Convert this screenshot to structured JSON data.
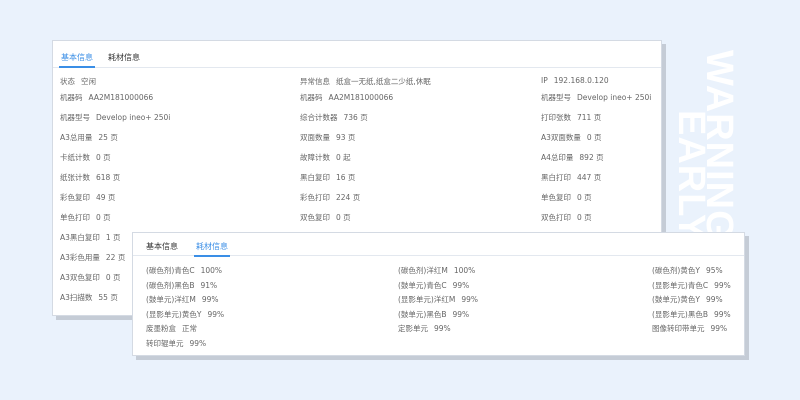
{
  "watermark": {
    "line1": "WARNING",
    "line2": "EARLY"
  },
  "colors": {
    "accent": "#3a8ee6",
    "background": "#eaf2fc"
  },
  "back_card": {
    "tabs": [
      "基本信息",
      "耗材信息"
    ],
    "active_tab": 0,
    "columns": [
      [
        [
          "状态",
          "空闲"
        ],
        [
          "机器码",
          "AA2M181000066"
        ],
        [
          "机器型号",
          "Develop ineo+ 250i"
        ],
        [
          "A3总用量",
          "25 页"
        ],
        [
          "卡纸计数",
          "0 页"
        ],
        [
          "纸张计数",
          "618 页"
        ],
        [
          "彩色复印",
          "49 页"
        ],
        [
          "单色打印",
          "0 页"
        ],
        [
          "A3黑白复印",
          "1 页"
        ],
        [
          "A3彩色用量",
          "22 页"
        ],
        [
          "A3双色复印",
          "0 页"
        ],
        [
          "A3扫描数",
          "55 页"
        ]
      ],
      [
        [
          "异常信息",
          "纸盒一无纸,纸盒二少纸,休眠"
        ],
        [
          "机器码",
          "AA2M181000066"
        ],
        [
          "综合计数器",
          "736 页"
        ],
        [
          "双面数量",
          "93 页"
        ],
        [
          "故障计数",
          "0 起"
        ],
        [
          "黑白复印",
          "16 页"
        ],
        [
          "彩色打印",
          "224 页"
        ],
        [
          "双色复印",
          "0 页"
        ]
      ],
      [
        [
          "IP",
          "192.168.0.120"
        ],
        [
          "机器型号",
          "Develop ineo+ 250i"
        ],
        [
          "打印张数",
          "711 页"
        ],
        [
          "A3双面数量",
          "0 页"
        ],
        [
          "A4总印量",
          "892 页"
        ],
        [
          "黑白打印",
          "447 页"
        ],
        [
          "单色复印",
          "0 页"
        ],
        [
          "双色打印",
          "0 页"
        ]
      ]
    ]
  },
  "front_card": {
    "tabs": [
      "基本信息",
      "耗材信息"
    ],
    "active_tab": 1,
    "columns": [
      [
        [
          "(碳色剂)青色C",
          "100%"
        ],
        [
          "(碳色剂)黑色B",
          "91%"
        ],
        [
          "(鼓单元)洋红M",
          "99%"
        ],
        [
          "(显影单元)黄色Y",
          "99%"
        ],
        [
          "废墨粉盒",
          "正常"
        ],
        [
          "转印辊单元",
          "99%"
        ]
      ],
      [
        [
          "(碳色剂)洋红M",
          "100%"
        ],
        [
          "(鼓单元)青色C",
          "99%"
        ],
        [
          "(显影单元)洋红M",
          "99%"
        ],
        [
          "(鼓单元)黑色B",
          "99%"
        ],
        [
          "定影单元",
          "99%"
        ]
      ],
      [
        [
          "(碳色剂)黄色Y",
          "95%"
        ],
        [
          "(显影单元)青色C",
          "99%"
        ],
        [
          "(鼓单元)黄色Y",
          "99%"
        ],
        [
          "(显影单元)黑色B",
          "99%"
        ],
        [
          "图像转印带单元",
          "99%"
        ]
      ]
    ]
  }
}
